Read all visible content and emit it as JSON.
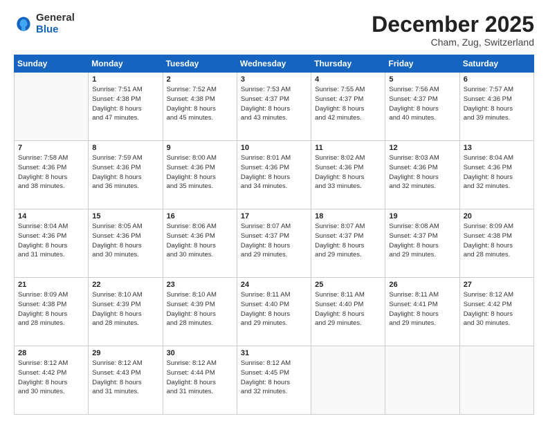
{
  "logo": {
    "general": "General",
    "blue": "Blue"
  },
  "title": {
    "month": "December 2025",
    "location": "Cham, Zug, Switzerland"
  },
  "weekdays": [
    "Sunday",
    "Monday",
    "Tuesday",
    "Wednesday",
    "Thursday",
    "Friday",
    "Saturday"
  ],
  "weeks": [
    [
      {
        "day": "",
        "info": ""
      },
      {
        "day": "1",
        "info": "Sunrise: 7:51 AM\nSunset: 4:38 PM\nDaylight: 8 hours\nand 47 minutes."
      },
      {
        "day": "2",
        "info": "Sunrise: 7:52 AM\nSunset: 4:38 PM\nDaylight: 8 hours\nand 45 minutes."
      },
      {
        "day": "3",
        "info": "Sunrise: 7:53 AM\nSunset: 4:37 PM\nDaylight: 8 hours\nand 43 minutes."
      },
      {
        "day": "4",
        "info": "Sunrise: 7:55 AM\nSunset: 4:37 PM\nDaylight: 8 hours\nand 42 minutes."
      },
      {
        "day": "5",
        "info": "Sunrise: 7:56 AM\nSunset: 4:37 PM\nDaylight: 8 hours\nand 40 minutes."
      },
      {
        "day": "6",
        "info": "Sunrise: 7:57 AM\nSunset: 4:36 PM\nDaylight: 8 hours\nand 39 minutes."
      }
    ],
    [
      {
        "day": "7",
        "info": "Sunrise: 7:58 AM\nSunset: 4:36 PM\nDaylight: 8 hours\nand 38 minutes."
      },
      {
        "day": "8",
        "info": "Sunrise: 7:59 AM\nSunset: 4:36 PM\nDaylight: 8 hours\nand 36 minutes."
      },
      {
        "day": "9",
        "info": "Sunrise: 8:00 AM\nSunset: 4:36 PM\nDaylight: 8 hours\nand 35 minutes."
      },
      {
        "day": "10",
        "info": "Sunrise: 8:01 AM\nSunset: 4:36 PM\nDaylight: 8 hours\nand 34 minutes."
      },
      {
        "day": "11",
        "info": "Sunrise: 8:02 AM\nSunset: 4:36 PM\nDaylight: 8 hours\nand 33 minutes."
      },
      {
        "day": "12",
        "info": "Sunrise: 8:03 AM\nSunset: 4:36 PM\nDaylight: 8 hours\nand 32 minutes."
      },
      {
        "day": "13",
        "info": "Sunrise: 8:04 AM\nSunset: 4:36 PM\nDaylight: 8 hours\nand 32 minutes."
      }
    ],
    [
      {
        "day": "14",
        "info": "Sunrise: 8:04 AM\nSunset: 4:36 PM\nDaylight: 8 hours\nand 31 minutes."
      },
      {
        "day": "15",
        "info": "Sunrise: 8:05 AM\nSunset: 4:36 PM\nDaylight: 8 hours\nand 30 minutes."
      },
      {
        "day": "16",
        "info": "Sunrise: 8:06 AM\nSunset: 4:36 PM\nDaylight: 8 hours\nand 30 minutes."
      },
      {
        "day": "17",
        "info": "Sunrise: 8:07 AM\nSunset: 4:37 PM\nDaylight: 8 hours\nand 29 minutes."
      },
      {
        "day": "18",
        "info": "Sunrise: 8:07 AM\nSunset: 4:37 PM\nDaylight: 8 hours\nand 29 minutes."
      },
      {
        "day": "19",
        "info": "Sunrise: 8:08 AM\nSunset: 4:37 PM\nDaylight: 8 hours\nand 29 minutes."
      },
      {
        "day": "20",
        "info": "Sunrise: 8:09 AM\nSunset: 4:38 PM\nDaylight: 8 hours\nand 28 minutes."
      }
    ],
    [
      {
        "day": "21",
        "info": "Sunrise: 8:09 AM\nSunset: 4:38 PM\nDaylight: 8 hours\nand 28 minutes."
      },
      {
        "day": "22",
        "info": "Sunrise: 8:10 AM\nSunset: 4:39 PM\nDaylight: 8 hours\nand 28 minutes."
      },
      {
        "day": "23",
        "info": "Sunrise: 8:10 AM\nSunset: 4:39 PM\nDaylight: 8 hours\nand 28 minutes."
      },
      {
        "day": "24",
        "info": "Sunrise: 8:11 AM\nSunset: 4:40 PM\nDaylight: 8 hours\nand 29 minutes."
      },
      {
        "day": "25",
        "info": "Sunrise: 8:11 AM\nSunset: 4:40 PM\nDaylight: 8 hours\nand 29 minutes."
      },
      {
        "day": "26",
        "info": "Sunrise: 8:11 AM\nSunset: 4:41 PM\nDaylight: 8 hours\nand 29 minutes."
      },
      {
        "day": "27",
        "info": "Sunrise: 8:12 AM\nSunset: 4:42 PM\nDaylight: 8 hours\nand 30 minutes."
      }
    ],
    [
      {
        "day": "28",
        "info": "Sunrise: 8:12 AM\nSunset: 4:42 PM\nDaylight: 8 hours\nand 30 minutes."
      },
      {
        "day": "29",
        "info": "Sunrise: 8:12 AM\nSunset: 4:43 PM\nDaylight: 8 hours\nand 31 minutes."
      },
      {
        "day": "30",
        "info": "Sunrise: 8:12 AM\nSunset: 4:44 PM\nDaylight: 8 hours\nand 31 minutes."
      },
      {
        "day": "31",
        "info": "Sunrise: 8:12 AM\nSunset: 4:45 PM\nDaylight: 8 hours\nand 32 minutes."
      },
      {
        "day": "",
        "info": ""
      },
      {
        "day": "",
        "info": ""
      },
      {
        "day": "",
        "info": ""
      }
    ]
  ]
}
